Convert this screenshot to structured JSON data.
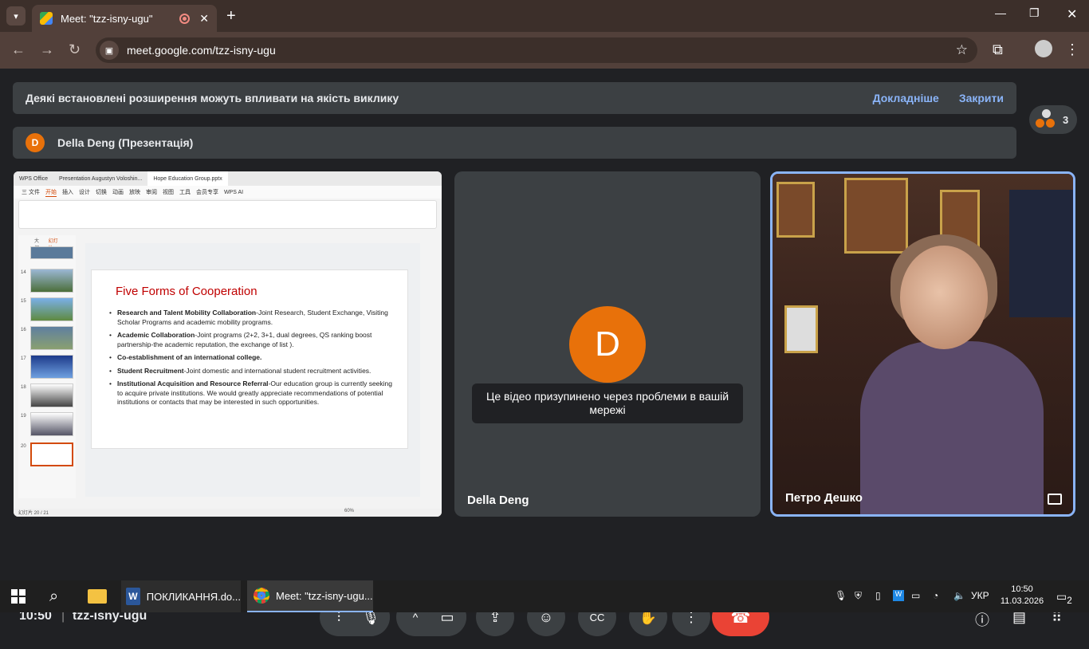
{
  "browser": {
    "tab_title": "Meet: \"tzz-isny-ugu\"",
    "url": "meet.google.com/tzz-isny-ugu",
    "tab_close": "✕",
    "new_tab": "+",
    "minimize": "—",
    "maximize": "❐",
    "close": "✕"
  },
  "banner": {
    "message": "Деякі встановлені розширення можуть впливати на якість виклику",
    "learn_more": "Докладніше",
    "close": "Закрити"
  },
  "presentation_bar": {
    "avatar_letter": "D",
    "label": "Della Deng (Презентація)"
  },
  "participants_count": "3",
  "wps": {
    "tabs": [
      "WPS Office",
      "Presentation Augustyn Voloshin...",
      "Hope Education Group.pptx"
    ],
    "menu": [
      "三 文件",
      "开始",
      "插入",
      "设计",
      "切换",
      "动画",
      "放映",
      "审阅",
      "视图",
      "工具",
      "会员专享",
      "WPS AI"
    ],
    "side_tabs": [
      "大纲",
      "幻灯片"
    ],
    "thumb_numbers": [
      "14",
      "15",
      "16",
      "17",
      "18",
      "19",
      "20"
    ],
    "slide": {
      "title": "Five Forms of Cooperation",
      "bullets": [
        {
          "bold": "Research and Talent Mobility Collaboration",
          "text": "-Joint Research, Student Exchange, Visiting Scholar Programs and academic mobility programs."
        },
        {
          "bold": "Academic Collaboration",
          "text": "-Joint programs (2+2, 3+1, dual degrees, QS ranking boost partnership-the academic reputation, the exchange of list )."
        },
        {
          "bold": "Co-establishment of an international college.",
          "text": ""
        },
        {
          "bold": "Student Recruitment",
          "text": "-Joint domestic and international student recruitment activities."
        },
        {
          "bold": "Institutional Acquisition and Resource Referral",
          "text": "-Our education group is currently seeking to acquire private institutions. We would greatly appreciate recommendations of potential institutions or contacts that may be interested in such opportunities."
        }
      ]
    },
    "status": "幻灯片 20 / 21",
    "zoom": "60%"
  },
  "tiles": {
    "della": {
      "avatar_letter": "D",
      "paused_message": "Це відео призупинено через проблеми в вашій мережі",
      "name": "Della Deng"
    },
    "petro": {
      "name": "Петро Дешко"
    }
  },
  "controls": {
    "time": "10:50",
    "separator": "|",
    "meeting_code": "tzz-isny-ugu"
  },
  "taskbar": {
    "word_app": "ПОКЛИКАННЯ.do...",
    "chrome_app": "Meet: \"tzz-isny-ugu...",
    "lang": "УКР",
    "time": "10:50",
    "date": "11.03.2026",
    "notifications": "2"
  },
  "colors": {
    "avatar_orange": "#e8710a",
    "hangup_red": "#ea4335",
    "link_blue": "#8ab4f8",
    "slide_title_red": "#c00000"
  }
}
